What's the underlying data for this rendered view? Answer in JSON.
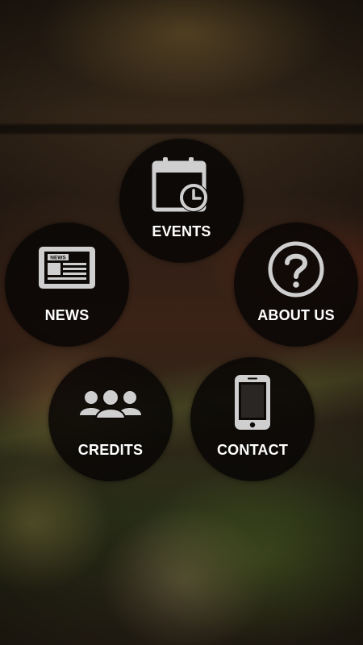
{
  "menu": {
    "events": {
      "label": "EVENTS",
      "icon": "calendar-clock-icon"
    },
    "news": {
      "label": "NEWS",
      "icon": "newspaper-tablet-icon",
      "icon_text": "NEWS"
    },
    "about": {
      "label": "ABOUT US",
      "icon": "question-icon"
    },
    "credits": {
      "label": "CREDITS",
      "icon": "people-group-icon"
    },
    "contact": {
      "label": "CONTACT",
      "icon": "smartphone-icon"
    }
  },
  "colors": {
    "circle_bg": "#0c0907",
    "label": "#ffffff",
    "icon": "#cfcfcf"
  }
}
